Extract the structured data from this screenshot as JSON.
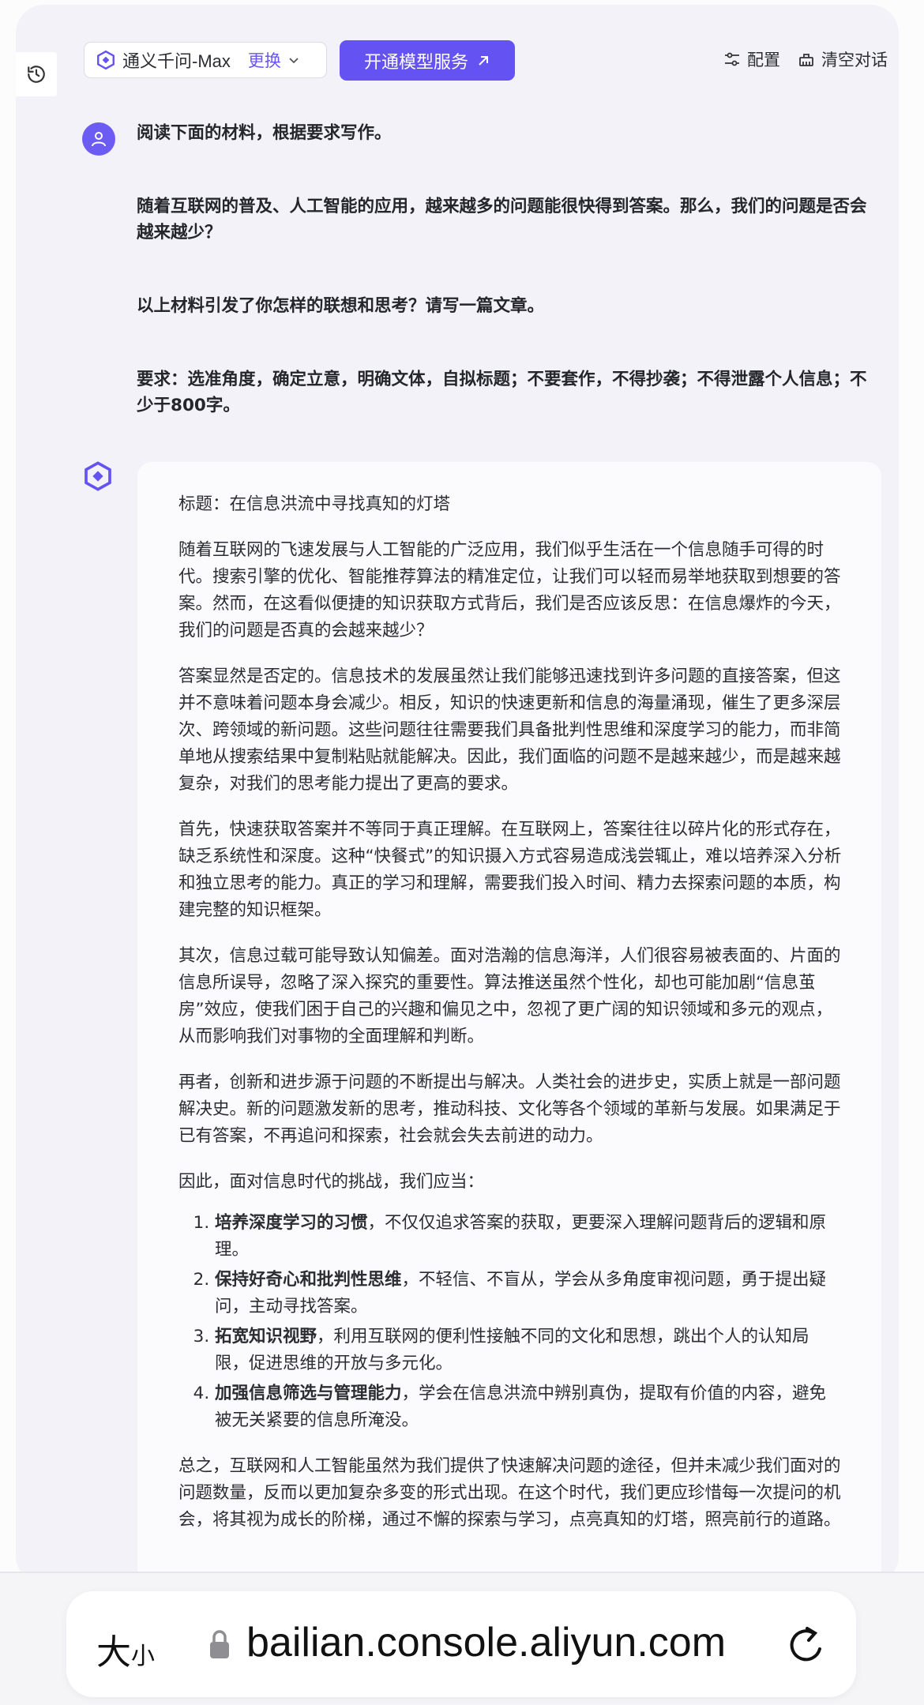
{
  "header": {
    "model_name": "通义千问-Max",
    "change_label": "更换",
    "open_service_label": "开通模型服务",
    "config_label": "配置",
    "clear_label": "清空对话",
    "accent_color": "#6552f2"
  },
  "user_message": {
    "paragraphs": [
      "阅读下面的材料，根据要求写作。",
      "随着互联网的普及、人工智能的应用，越来越多的问题能很快得到答案。那么，我们的问题是否会越来越少？",
      "以上材料引发了你怎样的联想和思考？请写一篇文章。",
      "要求：选准角度，确定立意，明确文体，自拟标题；不要套作，不得抄袭；不得泄露个人信息；不少于800字。"
    ]
  },
  "answer": {
    "title": "标题：在信息洪流中寻找真知的灯塔",
    "p1": "随着互联网的飞速发展与人工智能的广泛应用，我们似乎生活在一个信息随手可得的时代。搜索引擎的优化、智能推荐算法的精准定位，让我们可以轻而易举地获取到想要的答案。然而，在这看似便捷的知识获取方式背后，我们是否应该反思：在信息爆炸的今天，我们的问题是否真的会越来越少？",
    "p2": "答案显然是否定的。信息技术的发展虽然让我们能够迅速找到许多问题的直接答案，但这并不意味着问题本身会减少。相反，知识的快速更新和信息的海量涌现，催生了更多深层次、跨领域的新问题。这些问题往往需要我们具备批判性思维和深度学习的能力，而非简单地从搜索结果中复制粘贴就能解决。因此，我们面临的问题不是越来越少，而是越来越复杂，对我们的思考能力提出了更高的要求。",
    "p3": "首先，快速获取答案并不等同于真正理解。在互联网上，答案往往以碎片化的形式存在，缺乏系统性和深度。这种“快餐式”的知识摄入方式容易造成浅尝辄止，难以培养深入分析和独立思考的能力。真正的学习和理解，需要我们投入时间、精力去探索问题的本质，构建完整的知识框架。",
    "p4": "其次，信息过载可能导致认知偏差。面对浩瀚的信息海洋，人们很容易被表面的、片面的信息所误导，忽略了深入探究的重要性。算法推送虽然个性化，却也可能加剧“信息茧房”效应，使我们困于自己的兴趣和偏见之中，忽视了更广阔的知识领域和多元的观点，从而影响我们对事物的全面理解和判断。",
    "p5": "再者，创新和进步源于问题的不断提出与解决。人类社会的进步史，实质上就是一部问题解决史。新的问题激发新的思考，推动科技、文化等各个领域的革新与发展。如果满足于已有答案，不再追问和探索，社会就会失去前进的动力。",
    "p6": "因此，面对信息时代的挑战，我们应当：",
    "list": [
      {
        "bold": "培养深度学习的习惯",
        "text": "，不仅仅追求答案的获取，更要深入理解问题背后的逻辑和原理。"
      },
      {
        "bold": "保持好奇心和批判性思维",
        "text": "，不轻信、不盲从，学会从多角度审视问题，勇于提出疑问，主动寻找答案。"
      },
      {
        "bold": "拓宽知识视野",
        "text": "，利用互联网的便利性接触不同的文化和思想，跳出个人的认知局限，促进思维的开放与多元化。"
      },
      {
        "bold": "加强信息筛选与管理能力",
        "text": "，学会在信息洪流中辨别真伪，提取有价值的内容，避免被无关紧要的信息所淹没。"
      }
    ],
    "p7": "总之，互联网和人工智能虽然为我们提供了快速解决问题的途径，但并未减少我们面对的问题数量，反而以更加复杂多变的形式出现。在这个时代，我们更应珍惜每一次提问的机会，将其视为成长的阶梯，通过不懈的探索与学习，点亮真知的灯塔，照亮前行的道路。"
  },
  "browser": {
    "text_size_big": "大",
    "text_size_small": "小",
    "url": "bailian.console.aliyun.com"
  }
}
